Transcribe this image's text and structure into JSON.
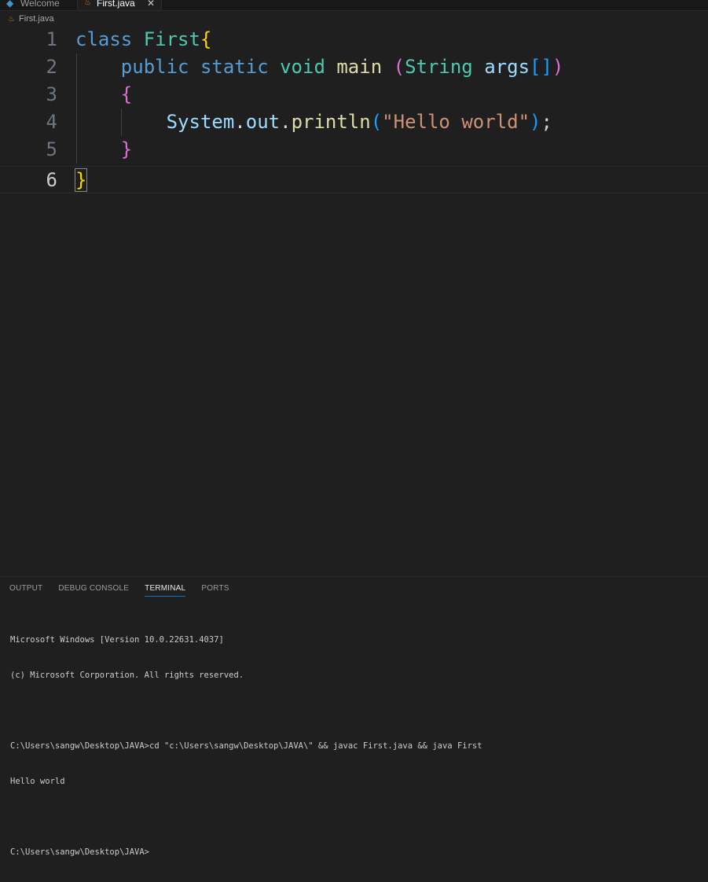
{
  "tabs": [
    {
      "label": "Welcome",
      "icon": "vscode-icon"
    },
    {
      "label": "First.java",
      "icon": "java-file-icon",
      "close": "✕"
    }
  ],
  "breadcrumb": {
    "file": "First.java"
  },
  "editor": {
    "line_numbers": [
      "1",
      "2",
      "3",
      "4",
      "5",
      "6"
    ],
    "active_line": "6"
  },
  "panel": {
    "tabs": [
      "OUTPUT",
      "DEBUG CONSOLE",
      "TERMINAL",
      "PORTS"
    ],
    "active_tab": "TERMINAL",
    "terminal_lines": [
      "Microsoft Windows [Version 10.0.22631.4037]",
      "(c) Microsoft Corporation. All rights reserved.",
      "",
      "C:\\Users\\sangw\\Desktop\\JAVA>cd \"c:\\Users\\sangw\\Desktop\\JAVA\\\" && javac First.java && java First",
      "Hello world",
      "",
      "C:\\Users\\sangw\\Desktop\\JAVA>"
    ]
  },
  "colors": {
    "background": "#1f1f1f",
    "keyword": "#569cd6",
    "type": "#4ec9b0",
    "function": "#dcdcaa",
    "variable": "#9cdcfe",
    "string": "#ce9178",
    "bracket_gold": "#ffd700",
    "bracket_pink": "#da70d6",
    "bracket_blue": "#179fff",
    "accent": "#0078d4"
  }
}
